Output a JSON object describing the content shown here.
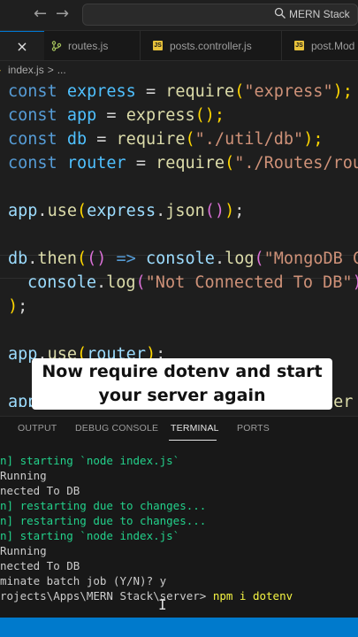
{
  "titlebar": {
    "back_arrow": "←",
    "forward_arrow": "→",
    "search_text": "MERN Stack"
  },
  "tabs": {
    "close_glyph": "×",
    "items": [
      {
        "label": "routes.js"
      },
      {
        "label": "posts.controller.js",
        "badge": "JS"
      },
      {
        "label": "post.Mod",
        "badge": "JS"
      }
    ]
  },
  "breadcrumb": {
    "file": "index.js",
    "sep": ">",
    "rest": "..."
  },
  "code": {
    "l1": [
      "const",
      "express",
      "=",
      "require",
      "(",
      "\"express\"",
      ");"
    ],
    "l2": [
      "const",
      "app",
      "=",
      "express",
      "();"
    ],
    "l3": [
      "const",
      "db",
      "=",
      "require",
      "(",
      "\"./util/db\"",
      ");"
    ],
    "l4": [
      "const",
      "router",
      "=",
      "require",
      "(",
      "\"./Routes/rout"
    ],
    "l6": [
      "app",
      ".",
      "use",
      "(",
      "express",
      ".",
      "json",
      "()",
      ")",
      ";"
    ],
    "l8": [
      "db",
      ".",
      "then",
      "(",
      "()",
      "=>",
      "console",
      ".",
      "log",
      "(",
      "\"MongoDB Co"
    ],
    "l9": [
      "console",
      ".",
      "log",
      "(",
      "\"Not Connected To DB\"",
      ")"
    ],
    "l10": [
      ")",
      ";"
    ],
    "l12": [
      "app",
      ".",
      "use",
      "(",
      "router",
      ")",
      ";"
    ],
    "l14_start": "app",
    "l14_end": "ver"
  },
  "caption": {
    "line1": "Now require dotenv and start",
    "line2": "your server again"
  },
  "panel": {
    "tabs": [
      "OUTPUT",
      "DEBUG CONSOLE",
      "TERMINAL",
      "PORTS"
    ],
    "active_tab": "TERMINAL"
  },
  "terminal": {
    "lines": [
      {
        "text": "n] starting `node index.js`",
        "color": "green"
      },
      {
        "text": "Running",
        "color": "white"
      },
      {
        "text": "nected To DB",
        "color": "white"
      },
      {
        "text": "n] restarting due to changes...",
        "color": "green"
      },
      {
        "text": "n] restarting due to changes...",
        "color": "green"
      },
      {
        "text": "n] starting `node index.js`",
        "color": "green"
      },
      {
        "text": "Running",
        "color": "white"
      },
      {
        "text": "nected To DB",
        "color": "white"
      },
      {
        "text": "minate batch job (Y/N)? y",
        "color": "white"
      }
    ],
    "prompt_path": "rojects\\Apps\\MERN Stack\\server>",
    "command": "npm i dotenv"
  },
  "colors": {
    "accent": "#0078d4",
    "statusbar": "#007acc",
    "keyword": "#569cd6",
    "string": "#ce9178",
    "function": "#dcdcaa",
    "terminal_green": "#23d18b"
  }
}
